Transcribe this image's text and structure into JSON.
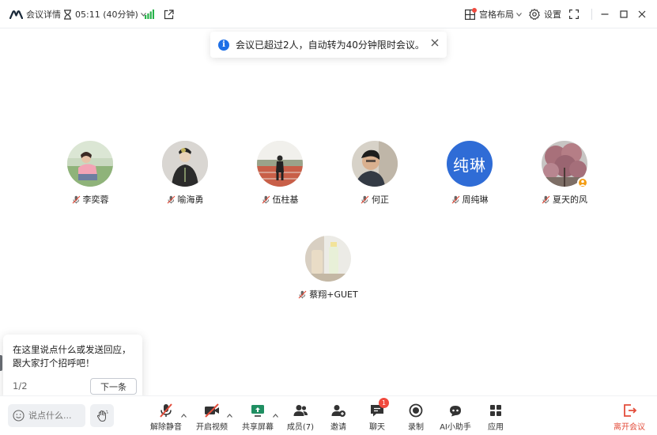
{
  "topbar": {
    "meeting_details": "会议详情",
    "timer": "05:11 (40分钟)",
    "layout": "宫格布局",
    "settings": "设置"
  },
  "notice": {
    "message": "会议已超过2人，自动转为40分钟限时会议。"
  },
  "participants": [
    {
      "name": "李奕蓉",
      "avatar": "photo"
    },
    {
      "name": "喻海勇",
      "avatar": "photo"
    },
    {
      "name": "伍柱基",
      "avatar": "photo"
    },
    {
      "name": "何正",
      "avatar": "photo"
    },
    {
      "name": "周纯琳",
      "avatar": "text",
      "avatar_text": "纯琳"
    },
    {
      "name": "夏天的风",
      "avatar": "photo",
      "host": true
    },
    {
      "name": "蔡翔+GUET",
      "avatar": "photo"
    }
  ],
  "tip": {
    "text": "在这里说点什么或发送回应，跟大家打个招呼吧！",
    "page": "1/2",
    "next_label": "下一条"
  },
  "bottombar": {
    "say_placeholder": "说点什么...",
    "unmute": "解除静音",
    "start_video": "开启视频",
    "share_screen": "共享屏幕",
    "members": "成员(7)",
    "invite": "邀请",
    "chat": "聊天",
    "chat_badge": "1",
    "record": "录制",
    "ai_assistant": "AI小助手",
    "apps": "应用",
    "leave": "离开会议"
  },
  "colors": {
    "accent": "#1e6fe6",
    "danger": "#e34d3b",
    "signal": "#27b24a",
    "avatar_blue": "#2f6cd6"
  }
}
